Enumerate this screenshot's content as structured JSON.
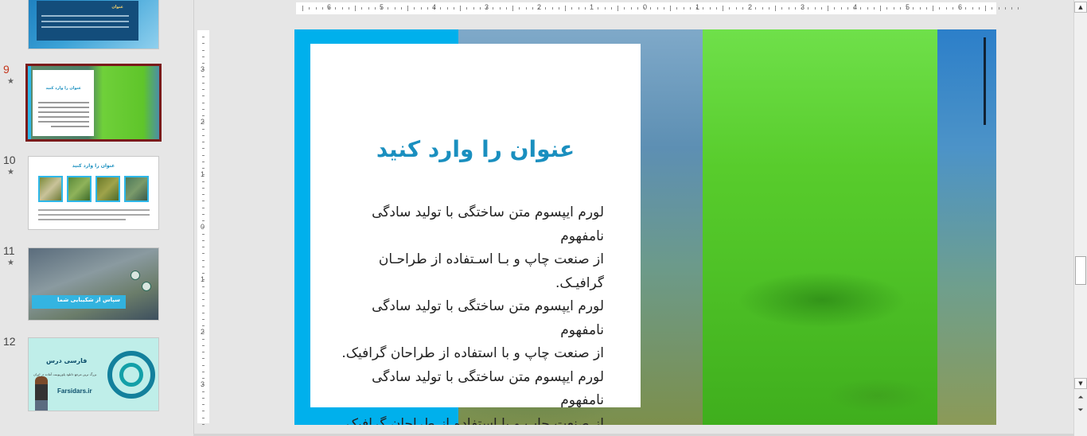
{
  "thumbnails": [
    {
      "number": "",
      "star": "",
      "title": "",
      "selected": false
    },
    {
      "number": "9",
      "star": "★",
      "title": "عنوان را وارد کنید",
      "selected": true
    },
    {
      "number": "10",
      "star": "★",
      "title": "عنوان را وارد کنید",
      "selected": false
    },
    {
      "number": "11",
      "star": "★",
      "title": "سپاس از شکیبایی شما",
      "selected": false
    },
    {
      "number": "12",
      "star": "",
      "title": "فارسی درس",
      "tagline": "بزرگ ترین مرجع دانلود پاورپوینت آماده در ایران",
      "site": "Farsidars.ir",
      "selected": false
    }
  ],
  "thumbnail_scroll": {
    "up": "▲",
    "down": "▼"
  },
  "ruler": {
    "horizontal": [
      "6",
      "5",
      "4",
      "3",
      "2",
      "1",
      "0",
      "1",
      "2",
      "3",
      "4",
      "5",
      "6"
    ],
    "vertical": [
      "3",
      "2",
      "1",
      "0",
      "1",
      "2",
      "3"
    ]
  },
  "slide": {
    "title": "عنوان را وارد کنید",
    "body": "لورم ایپسوم متن ساختگی با تولید سادگی نامفهوم\nاز صنعت چاپ و بـا اسـتفاده از طراحـان گرافیـک.\nلورم ایپسوم متن ساختگی با تولید سادگی نامفهوم\nاز صنعت چاپ و با استفاده از طراحان گرافیک.\nلورم ایپسوم متن ساختگی با تولید سادگی نامفهوم\nاز صنعت چاپ و با استفاده از طراحان گرافیک."
  },
  "editor_scroll": {
    "up": "▲",
    "down": "▼",
    "prev_slide": "⏶",
    "next_slide": "⏷"
  },
  "colors": {
    "accent": "#00b0ec",
    "title": "#1a8fbf",
    "selected_border": "#7a1b1b"
  }
}
